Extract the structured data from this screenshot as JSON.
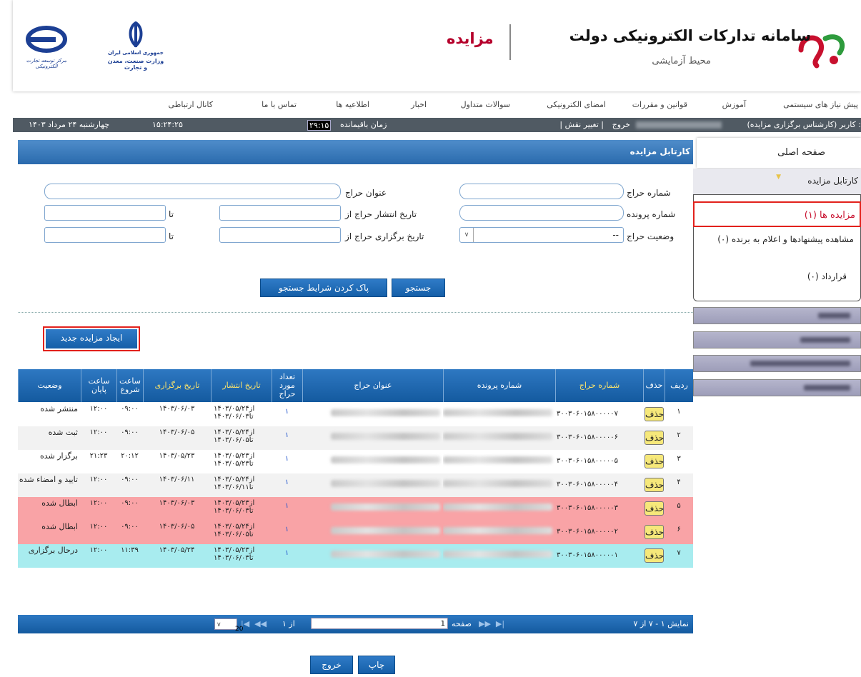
{
  "header": {
    "app_title": "سامانه تدارکات الکترونیکی دولت",
    "app_subtitle": "محیط آزمایشی",
    "section": "مزایده",
    "logo_ministry_text1": "جمهوری اسلامی ایران",
    "logo_ministry_text2": "وزارت صنعت، معدن و تجارت",
    "logo_center_text": "مرکز توسعه تجارت الکترونیکی"
  },
  "menu": [
    "پیش نیاز های سیستمی",
    "آموزش",
    "قوانین و مقررات",
    "امضای الکترونیکی",
    "سوالات متداول",
    "اخبار",
    "اطلاعیه ها",
    "تماس با ما",
    "کانال ارتباطی"
  ],
  "infobar": {
    "user": "کاربر (کارشناس برگزاری مزایده) :",
    "change_role": "| تغییر نقش |",
    "logout": "خروج",
    "remaining_label": "زمان باقیمانده",
    "remaining": "۲۹:۱۵",
    "time": "۱۵:۲۴:۲۵",
    "date": "چهارشنبه ۲۴ مرداد ۱۴۰۳"
  },
  "panel": {
    "title": "کارتابل مزایده"
  },
  "search": {
    "auction_no": "شماره حراج",
    "file_no": "شماره پرونده",
    "status": "وضعیت حراج",
    "status_value": "--",
    "auction_title": "عنوان حراج",
    "publish_from": "تاریخ انتشار حراج از",
    "hold_from": "تاریخ برگزاری حراج از",
    "to": "تا",
    "search_btn": "جستجو",
    "clear_btn": "پاک کردن شرایط جستجو"
  },
  "new_auction_btn": "ایجاد مزایده جدید",
  "table": {
    "headers": {
      "row": "ردیف",
      "del": "حذف",
      "auction_no": "شماره حراج",
      "file_no": "شماره پرونده",
      "title": "عنوان حراج",
      "count": "تعداد مورد حراج",
      "publish": "تاریخ انتشار",
      "hold": "تاریخ برگزاری",
      "start": "ساعت شروع",
      "end": "ساعت پایان",
      "status": "وضعیت"
    },
    "del_label": "حذف",
    "rows": [
      {
        "n": "۱",
        "no": "۳۰۰۳۰۶۰۱۵۸۰۰۰۰۰۷",
        "count": "۱",
        "pub1": "از۱۴۰۳/۰۵/۲۴",
        "pub2": "تا۱۴۰۳/۰۶/۰۳",
        "hold": "۱۴۰۳/۰۶/۰۳",
        "start": "۰۹:۰۰",
        "end": "۱۲:۰۰",
        "status": "منتشر شده",
        "bg": "#ffffff"
      },
      {
        "n": "۲",
        "no": "۳۰۰۳۰۶۰۱۵۸۰۰۰۰۰۶",
        "count": "۱",
        "pub1": "از۱۴۰۳/۰۵/۲۴",
        "pub2": "تا۱۴۰۳/۰۶/۰۵",
        "hold": "۱۴۰۳/۰۶/۰۵",
        "start": "۰۹:۰۰",
        "end": "۱۲:۰۰",
        "status": "ثبت شده",
        "bg": "#f2f2f2"
      },
      {
        "n": "۳",
        "no": "۳۰۰۳۰۶۰۱۵۸۰۰۰۰۰۵",
        "count": "۱",
        "pub1": "از۱۴۰۳/۰۵/۲۳",
        "pub2": "تا۱۴۰۳/۰۵/۲۳",
        "hold": "۱۴۰۳/۰۵/۲۳",
        "start": "۲۰:۱۲",
        "end": "۲۱:۲۳",
        "status": "برگزار شده",
        "bg": "#ffffff"
      },
      {
        "n": "۴",
        "no": "۳۰۰۳۰۶۰۱۵۸۰۰۰۰۰۴",
        "count": "۱",
        "pub1": "از۱۴۰۳/۰۵/۲۴",
        "pub2": "تا۱۴۰۳/۰۶/۱۱",
        "hold": "۱۴۰۳/۰۶/۱۱",
        "start": "۰۹:۰۰",
        "end": "۱۲:۰۰",
        "status": "تایید و امضاء شده",
        "bg": "#f2f2f2"
      },
      {
        "n": "۵",
        "no": "۳۰۰۳۰۶۰۱۵۸۰۰۰۰۰۳",
        "count": "۱",
        "pub1": "از۱۴۰۳/۰۵/۲۳",
        "pub2": "تا۱۴۰۳/۰۶/۰۳",
        "hold": "۱۴۰۳/۰۶/۰۳",
        "start": "۰۹:۰۰",
        "end": "۱۲:۰۰",
        "status": "ابطال شده",
        "bg": "#f9a3a6"
      },
      {
        "n": "۶",
        "no": "۳۰۰۳۰۶۰۱۵۸۰۰۰۰۰۲",
        "count": "۱",
        "pub1": "از۱۴۰۳/۰۵/۲۴",
        "pub2": "تا۱۴۰۳/۰۶/۰۵",
        "hold": "۱۴۰۳/۰۶/۰۵",
        "start": "۰۹:۰۰",
        "end": "۱۲:۰۰",
        "status": "ابطال شده",
        "bg": "#f9a3a6"
      },
      {
        "n": "۷",
        "no": "۳۰۰۳۰۶۰۱۵۸۰۰۰۰۰۱",
        "count": "۱",
        "pub1": "از۱۴۰۳/۰۵/۲۳",
        "pub2": "تا۱۴۰۳/۰۶/۰۳",
        "hold": "۱۴۰۳/۰۵/۲۴",
        "start": "۱۱:۳۹",
        "end": "۱۲:۰۰",
        "status": "درحال برگزاری",
        "bg": "#a8ecef"
      }
    ]
  },
  "pager": {
    "showing": "نمایش ۱ - ۷ از ۷",
    "page_label": "صفحه",
    "page_value": "1",
    "of": "از ۱",
    "page_size": "20"
  },
  "footer": {
    "print": "چاپ",
    "exit": "خروج"
  },
  "sidebar": {
    "home": "صفحه اصلی",
    "kartabl": "کارتابل مزایده",
    "items": [
      "مزایده ها (۱)",
      "مشاهده پیشنهادها و اعلام به برنده (۰)",
      "قرارداد (۰)"
    ]
  },
  "colors": {
    "brand_red": "#b5002b",
    "bar_blue": "#2e78c2",
    "canceled_row": "#f9a3a6",
    "running_row": "#a8ecef",
    "delete_btn": "#f6e87a"
  }
}
